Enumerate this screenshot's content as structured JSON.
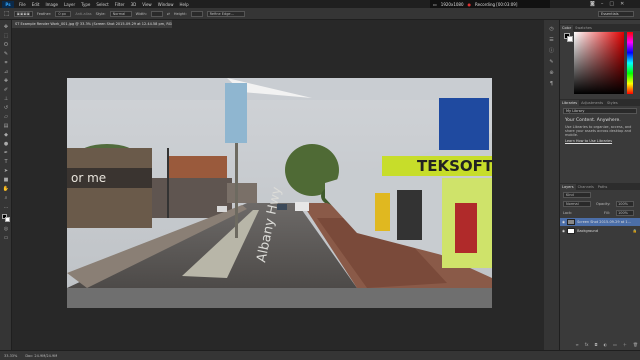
{
  "menu": {
    "items": [
      "File",
      "Edit",
      "Image",
      "Layer",
      "Type",
      "Select",
      "Filter",
      "3D",
      "View",
      "Window",
      "Help"
    ]
  },
  "recording": {
    "resolution": "1920x1080",
    "status": "Recording [00:03:09]"
  },
  "options": {
    "feather_label": "Feather:",
    "feather_value": "0 px",
    "antialias": "Anti-alias",
    "style_label": "Style:",
    "style_value": "Normal",
    "width_label": "Width:",
    "height_label": "Height:",
    "refine": "Refine Edge...",
    "workspace": "Essentials"
  },
  "document": {
    "tab": "ST Example Render Work_001.jpg @ 33.3% (Screen Shot 2015-09-29 at 12.44.58 pm, RGB/8#)"
  },
  "panels": {
    "color_tabs": [
      "Color",
      "Swatches"
    ],
    "library_tabs": [
      "Libraries",
      "Adjustments",
      "Styles"
    ],
    "library_select": "My Library",
    "library_title": "Your Content. Anywhere.",
    "library_body1": "Use Libraries to organize, access, and",
    "library_body2": "share your assets across desktop and",
    "library_body3": "mobile.",
    "library_link": "Learn How to Use Libraries",
    "layers_tabs": [
      "Layers",
      "Channels",
      "Paths"
    ],
    "layers_kind": "Kind",
    "blend_mode": "Normal",
    "opacity_label": "Opacity:",
    "opacity_value": "100%",
    "lock_label": "Lock:",
    "fill_label": "Fill:",
    "fill_value": "100%",
    "layer1": "Screen Shot 2015-09-29 at 1...",
    "layer2": "Background"
  },
  "status": {
    "zoom": "33.33%",
    "doc": "Doc: 24.9M/24.9M"
  },
  "scene": {
    "shop_sign": "TEKSOFT",
    "street_name": "Albany Hwy",
    "left_sign": "or   me"
  },
  "colors": {
    "accent": "#31a8ff",
    "record": "#e03030",
    "shop_green": "#c7dd2a"
  }
}
